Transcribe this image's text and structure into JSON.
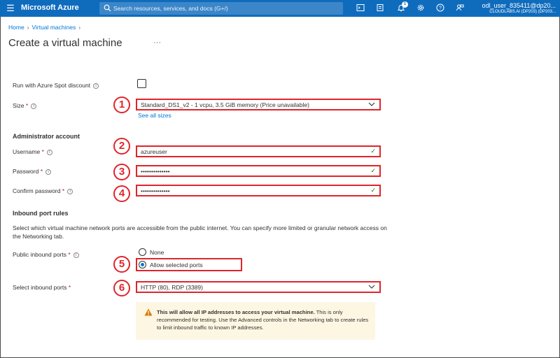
{
  "topbar": {
    "brand": "Microsoft Azure",
    "search_placeholder": "Search resources, services, and docs (G+/)",
    "notification_count": "1",
    "user_name": "odl_user_835411@dp20...",
    "user_tenant": "CLOUDLABS.AI (DP203) (DP203..."
  },
  "breadcrumb": {
    "home": "Home",
    "vms": "Virtual machines"
  },
  "page": {
    "title": "Create a virtual machine",
    "more": "···"
  },
  "form": {
    "spot_label": "Run with Azure Spot discount",
    "size_label": "Size",
    "size_value": "Standard_DS1_v2 - 1 vcpu, 3.5 GiB memory (Price unavailable)",
    "see_all_sizes": "See all sizes",
    "admin_section": "Administrator account",
    "username_label": "Username",
    "username_value": "azureuser",
    "password_label": "Password",
    "password_value": "••••••••••••••",
    "confirm_label": "Confirm password",
    "confirm_value": "••••••••••••••",
    "inbound_section": "Inbound port rules",
    "inbound_desc": "Select which virtual machine network ports are accessible from the public internet. You can specify more limited or granular network access on the Networking tab.",
    "public_ports_label": "Public inbound ports",
    "radio_none": "None",
    "radio_allow": "Allow selected ports",
    "select_ports_label": "Select inbound ports",
    "select_ports_value": "HTTP (80), RDP (3389)",
    "required_mark": "*",
    "warning_bold": "This will allow all IP addresses to access your virtual machine.",
    "warning_rest": " This is only recommended for testing.  Use the Advanced controls in the Networking tab to create rules to limit inbound traffic to known IP addresses."
  },
  "callouts": [
    "1",
    "2",
    "3",
    "4",
    "5",
    "6"
  ],
  "icons": [
    "hamburger-icon",
    "search-icon",
    "cloud-shell-icon",
    "directory-filter-icon",
    "bell-icon",
    "gear-icon",
    "help-icon",
    "feedback-icon",
    "info-icon",
    "chevron-down-icon",
    "checkmark-icon",
    "warning-icon"
  ],
  "colors": {
    "azure_blue": "#0f6cbd",
    "link": "#0078d4",
    "callout_red": "#e0252b",
    "required": "#a4262c",
    "valid_green": "#107c10",
    "warning_bg": "#fdf6e3"
  }
}
